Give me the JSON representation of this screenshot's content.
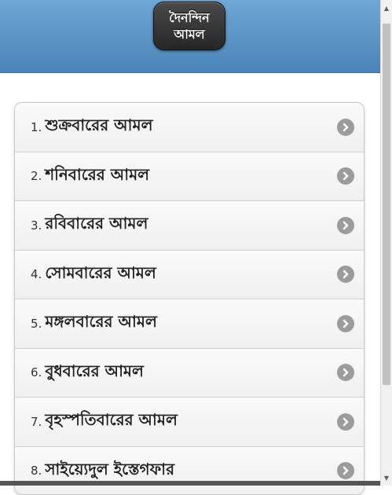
{
  "header": {
    "title": "দৈনন্দিন আমল"
  },
  "menu": {
    "items": [
      {
        "num": "1.",
        "label": "শুক্রবারের আমল"
      },
      {
        "num": "2.",
        "label": "শনিবারের আমল"
      },
      {
        "num": "3.",
        "label": "রবিবারের আমল"
      },
      {
        "num": "4.",
        "label": "সোমবারের আমল"
      },
      {
        "num": "5.",
        "label": "মঙ্গলবারের আমল"
      },
      {
        "num": "6.",
        "label": "বুধবারের আমল"
      },
      {
        "num": "7.",
        "label": "বৃহস্পতিবারের আমল"
      },
      {
        "num": "8.",
        "label": "সাইয়্যেদুল ইস্তেগফার"
      }
    ]
  },
  "icons": {
    "arrow": "chevron-right-circle-icon",
    "scroll_up": "arrow-up-icon",
    "scroll_down": "arrow-down-icon"
  },
  "colors": {
    "header_top": "#6fa8d6",
    "header_bottom": "#4a83b8",
    "title_button": "#333333",
    "arrow_bg": "#9c9c9c"
  }
}
